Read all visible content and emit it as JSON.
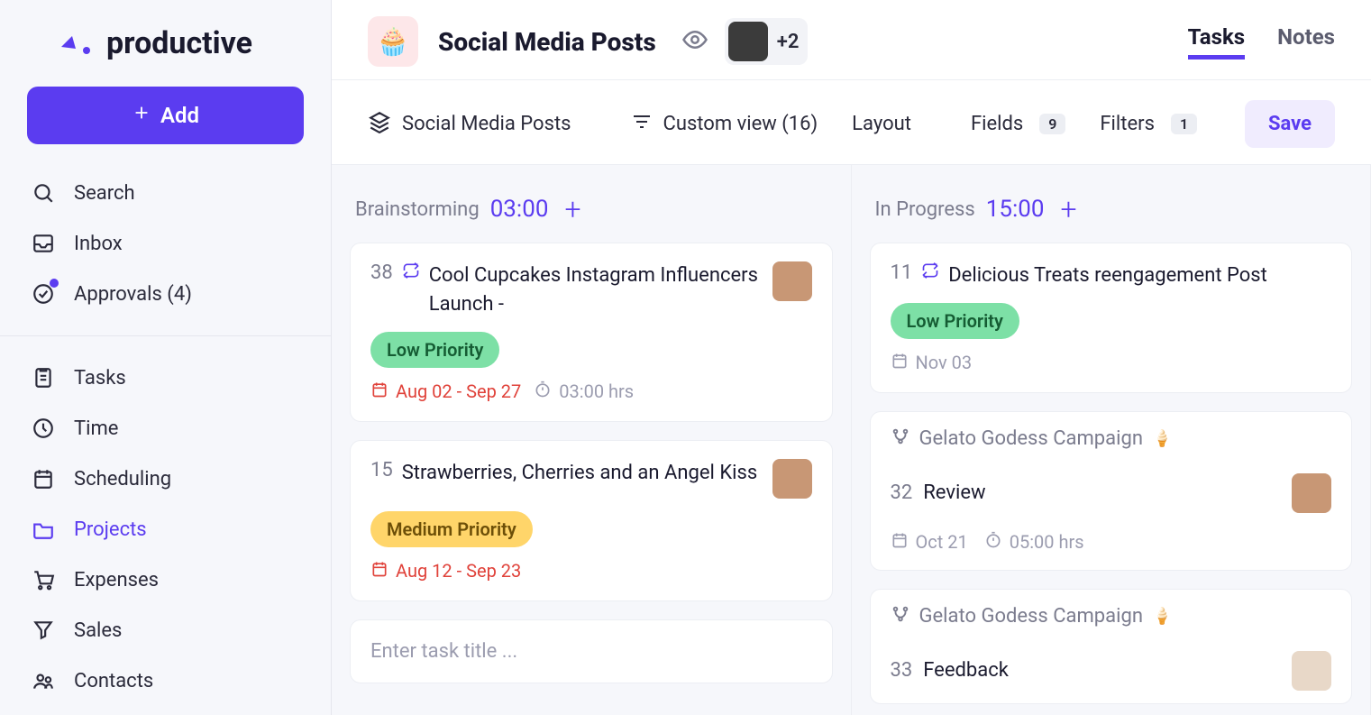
{
  "brand": "productive",
  "sidebar": {
    "add_label": "Add",
    "items": [
      {
        "label": "Search",
        "icon": "search-icon"
      },
      {
        "label": "Inbox",
        "icon": "inbox-icon"
      },
      {
        "label": "Approvals (4)",
        "icon": "approvals-icon",
        "dot": true
      }
    ],
    "nav": [
      {
        "label": "Tasks",
        "icon": "tasks-icon"
      },
      {
        "label": "Time",
        "icon": "time-icon"
      },
      {
        "label": "Scheduling",
        "icon": "scheduling-icon"
      },
      {
        "label": "Projects",
        "icon": "projects-icon",
        "active": true
      },
      {
        "label": "Expenses",
        "icon": "expenses-icon"
      },
      {
        "label": "Sales",
        "icon": "sales-icon"
      },
      {
        "label": "Contacts",
        "icon": "contacts-icon"
      }
    ]
  },
  "header": {
    "project_title": "Social Media Posts",
    "avatar_more": "+2",
    "tabs": [
      {
        "label": "Tasks",
        "active": true
      },
      {
        "label": "Notes",
        "active": false
      }
    ]
  },
  "toolbar": {
    "project_selector": "Social Media Posts",
    "view_label": "Custom view (16)",
    "layout_label": "Layout",
    "fields_label": "Fields",
    "fields_count": "9",
    "filters_label": "Filters",
    "filters_count": "1",
    "save_label": "Save"
  },
  "board": {
    "columns": [
      {
        "name": "Brainstorming",
        "time": "03:00",
        "cards": [
          {
            "num": "38",
            "repeat": true,
            "title": "Cool Cupcakes Instagram Influencers Launch -",
            "priority": {
              "label": "Low Priority",
              "level": "low"
            },
            "date": "Aug 02 - Sep 27",
            "date_color": "red",
            "hours": "03:00 hrs",
            "avatar": true
          },
          {
            "num": "15",
            "repeat": false,
            "title": "Strawberries, Cherries and an Angel Kiss",
            "priority": {
              "label": "Medium Priority",
              "level": "med"
            },
            "date": "Aug 12 - Sep 23",
            "date_color": "red",
            "avatar": true
          }
        ],
        "new_task_placeholder": "Enter task title ..."
      },
      {
        "name": "In Progress",
        "time": "15:00",
        "cards": [
          {
            "num": "11",
            "repeat": true,
            "title": "Delicious Treats reengagement Post",
            "priority": {
              "label": "Low Priority",
              "level": "low"
            },
            "date": "Nov 03",
            "date_color": "gray"
          }
        ],
        "sub_groups": [
          {
            "label": "Gelato Godess Campaign",
            "task": {
              "num": "32",
              "title": "Review",
              "date": "Oct 21",
              "hours": "05:00 hrs",
              "avatar": true
            }
          },
          {
            "label": "Gelato Godess Campaign",
            "task": {
              "num": "33",
              "title": "Feedback",
              "avatar": true
            }
          }
        ]
      }
    ]
  }
}
